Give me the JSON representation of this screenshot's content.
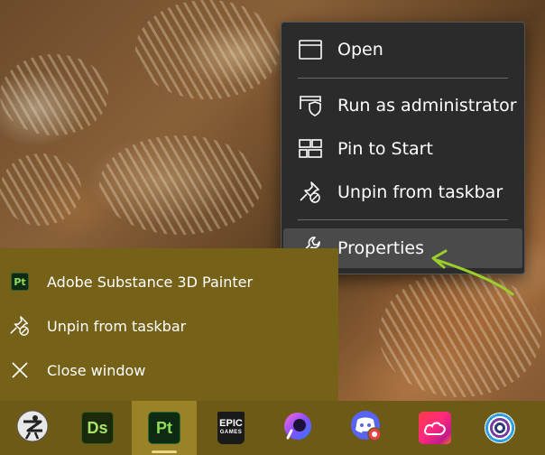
{
  "context_menu": {
    "items": [
      {
        "label": "Open",
        "icon": "window-icon"
      },
      {
        "label": "Run as administrator",
        "icon": "shield-window-icon"
      },
      {
        "label": "Pin to Start",
        "icon": "pin-start-icon"
      },
      {
        "label": "Unpin from taskbar",
        "icon": "unpin-icon"
      },
      {
        "label": "Properties",
        "icon": "wrench-icon"
      }
    ],
    "hovered": "Properties"
  },
  "jump_list": {
    "items": [
      {
        "label": "Adobe Substance 3D Painter",
        "icon": "substance-painter-icon",
        "badge": "Pt"
      },
      {
        "label": "Unpin from taskbar",
        "icon": "unpin-icon"
      },
      {
        "label": "Close window",
        "icon": "close-icon"
      }
    ]
  },
  "taskbar": {
    "apps": [
      {
        "name": "zbrush-icon"
      },
      {
        "name": "substance-designer-icon",
        "badge": "Ds"
      },
      {
        "name": "substance-painter-icon",
        "badge": "Pt",
        "active": true
      },
      {
        "name": "epic-games-icon",
        "badge": "EPIC",
        "sub": "GAMES"
      },
      {
        "name": "copilot-icon"
      },
      {
        "name": "discord-icon"
      },
      {
        "name": "creative-cloud-icon"
      },
      {
        "name": "ubisoft-connect-icon"
      }
    ]
  },
  "colors": {
    "menu_bg": "#2b2b2b",
    "menu_hover": "#4a4a4a",
    "jump_list_bg": "#766119",
    "taskbar_bg": "#6e5a17",
    "arrow": "#9ccf2a"
  }
}
